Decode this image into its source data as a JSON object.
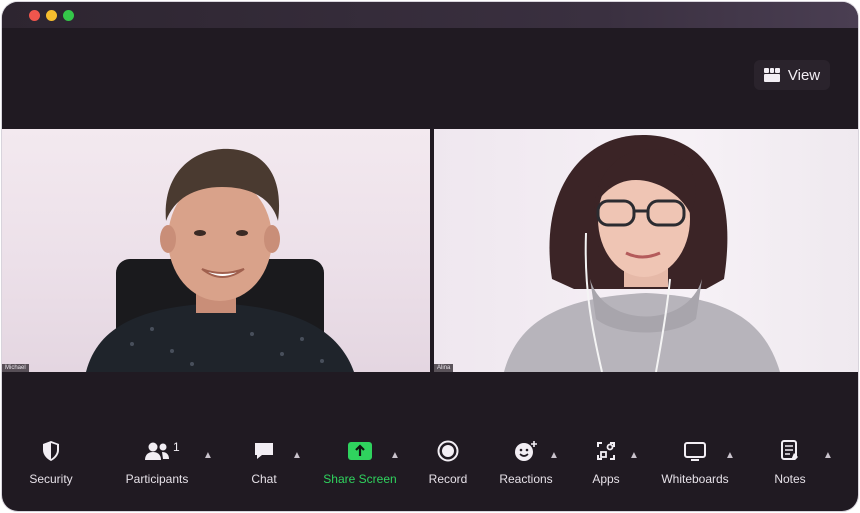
{
  "window": {
    "view_label": "View"
  },
  "participants": [
    {
      "name_tag": "Michael"
    },
    {
      "name_tag": "Alina"
    }
  ],
  "toolbar": {
    "security": "Security",
    "participants": "Participants",
    "participants_count": "1",
    "chat": "Chat",
    "share_screen": "Share Screen",
    "record": "Record",
    "reactions": "Reactions",
    "apps": "Apps",
    "whiteboards": "Whiteboards",
    "notes": "Notes"
  },
  "colors": {
    "share_screen_accent": "#2fd35e",
    "window_background": "#201a22"
  }
}
